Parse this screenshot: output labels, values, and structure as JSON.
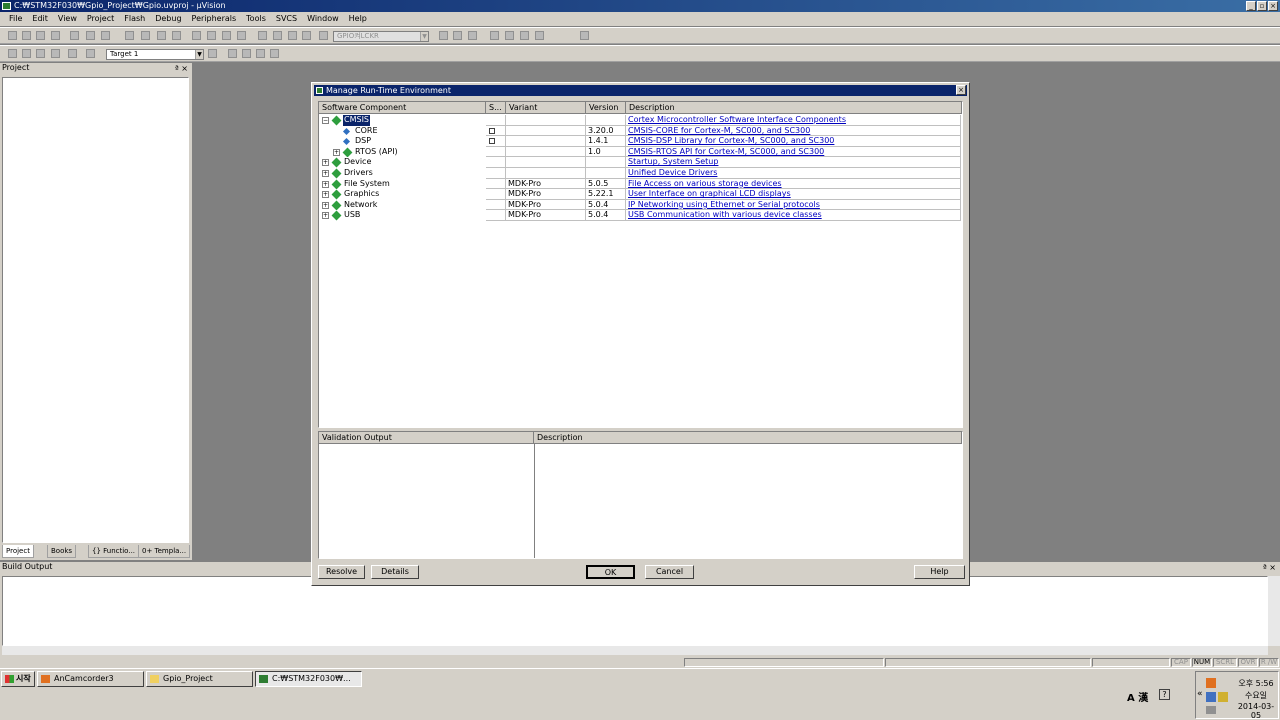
{
  "window": {
    "title": "C:₩STM32F030₩Gpio_Project₩Gpio.uvproj - µVision"
  },
  "menu": [
    "File",
    "Edit",
    "View",
    "Project",
    "Flash",
    "Debug",
    "Peripherals",
    "Tools",
    "SVCS",
    "Window",
    "Help"
  ],
  "toolbar": {
    "file_combo": "GPIO켜LCKR",
    "target_combo": "Target 1"
  },
  "project_panel": {
    "title": "Project",
    "tabs": [
      "Project",
      "Books",
      "{} Functio...",
      "0+ Templa..."
    ]
  },
  "build_output": {
    "title": "Build Output"
  },
  "dialog": {
    "title": "Manage Run-Time Environment",
    "columns": [
      "Software Component",
      "S...",
      "Variant",
      "Version",
      "Description"
    ],
    "rows": [
      {
        "name": "CMSIS",
        "level": 0,
        "expander": "−",
        "selected": true,
        "checkbox": false,
        "variant": "",
        "version": "",
        "desc": "Cortex Microcontroller Software Interface Components"
      },
      {
        "name": "CORE",
        "level": 1,
        "expander": "",
        "selected": false,
        "checkbox": true,
        "variant": "",
        "version": "3.20.0",
        "desc": "CMSIS-CORE for Cortex-M, SC000, and SC300"
      },
      {
        "name": "DSP",
        "level": 1,
        "expander": "",
        "selected": false,
        "checkbox": true,
        "variant": "",
        "version": "1.4.1",
        "desc": "CMSIS-DSP Library for Cortex-M, SC000, and SC300"
      },
      {
        "name": "RTOS (API)",
        "level": 1,
        "expander": "+",
        "selected": false,
        "checkbox": false,
        "variant": "",
        "version": "1.0",
        "desc": "CMSIS-RTOS API for Cortex-M, SC000, and SC300"
      },
      {
        "name": "Device",
        "level": 0,
        "expander": "+",
        "selected": false,
        "checkbox": false,
        "variant": "",
        "version": "",
        "desc": "Startup, System Setup"
      },
      {
        "name": "Drivers",
        "level": 0,
        "expander": "+",
        "selected": false,
        "checkbox": false,
        "variant": "",
        "version": "",
        "desc": "Unified Device Drivers"
      },
      {
        "name": "File System",
        "level": 0,
        "expander": "+",
        "selected": false,
        "checkbox": false,
        "variant": "MDK-Pro",
        "version": "5.0.5",
        "desc": "File Access on various storage devices"
      },
      {
        "name": "Graphics",
        "level": 0,
        "expander": "+",
        "selected": false,
        "checkbox": false,
        "variant": "MDK-Pro",
        "version": "5.22.1",
        "desc": "User Interface on graphical LCD displays"
      },
      {
        "name": "Network",
        "level": 0,
        "expander": "+",
        "selected": false,
        "checkbox": false,
        "variant": "MDK-Pro",
        "version": "5.0.4",
        "desc": "IP Networking using Ethernet or Serial protocols"
      },
      {
        "name": "USB",
        "level": 0,
        "expander": "+",
        "selected": false,
        "checkbox": false,
        "variant": "MDK-Pro",
        "version": "5.0.4",
        "desc": "USB Communication with various device classes"
      }
    ],
    "validation_columns": [
      "Validation Output",
      "Description"
    ],
    "buttons": {
      "resolve": "Resolve",
      "details": "Details",
      "ok": "OK",
      "cancel": "Cancel",
      "help": "Help"
    }
  },
  "statusbar": {
    "caps": "CAP",
    "num": "NUM",
    "scrl": "SCRL",
    "ovr": "OVR",
    "rw": "R /W"
  },
  "taskbar": {
    "start": "시작",
    "tasks": [
      "AnCamcorder3",
      "Gpio_Project",
      "C:₩STM32F030₩..."
    ],
    "clock": {
      "time": "오후 5:56",
      "day": "수요일",
      "date": "2014-03-05"
    },
    "ime": "A 漢"
  },
  "colors": {
    "title_bar": "#0a246a",
    "chrome": "#d4d0c8",
    "desktop": "#808080",
    "link": "#0000c0",
    "component_icon": "#2e9e3e"
  }
}
